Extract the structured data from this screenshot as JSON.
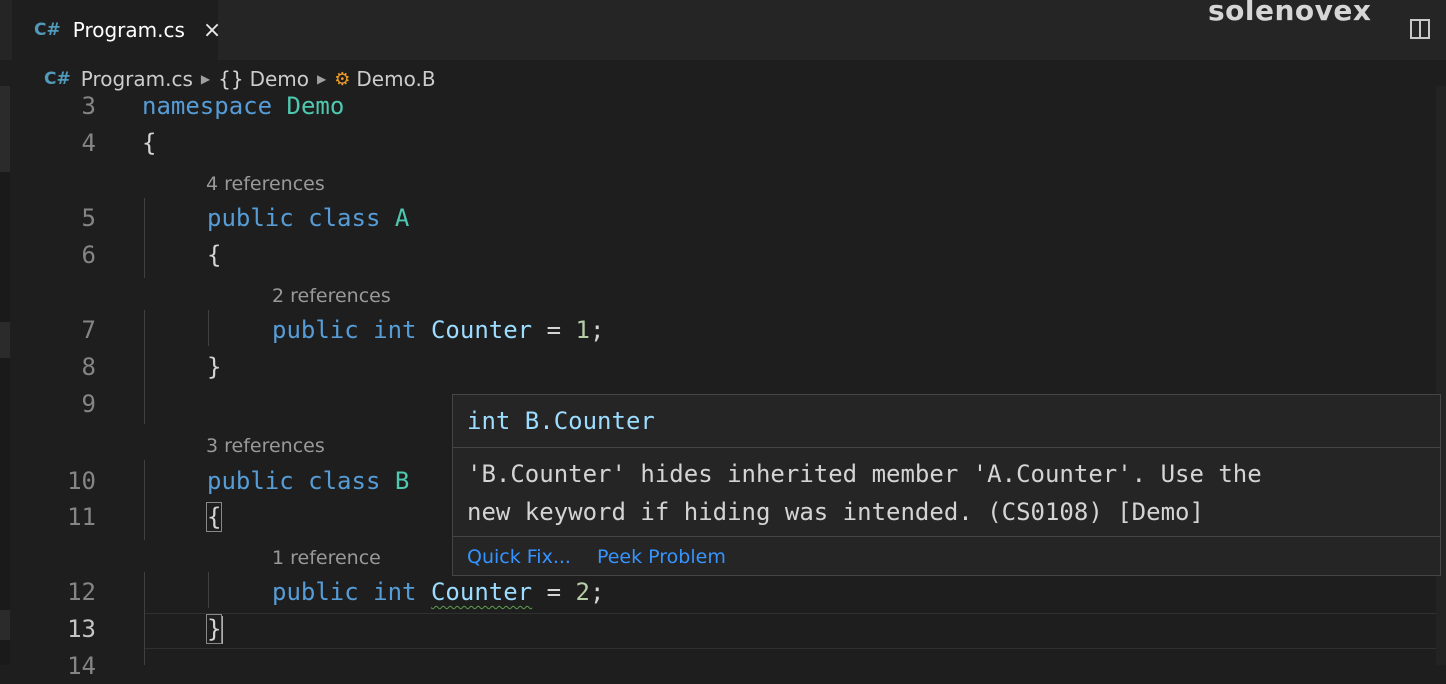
{
  "tab": {
    "label": "Program.cs",
    "icon": "csharp-file-icon",
    "close": "×"
  },
  "watermark": "solenovex",
  "breadcrumb": {
    "file": "Program.cs",
    "namespace_icon": "{}",
    "namespace": "Demo",
    "class": "Demo.B"
  },
  "editor": {
    "line_numbers": [
      "3",
      "4",
      "5",
      "6",
      "7",
      "8",
      "9",
      "10",
      "11",
      "12",
      "13",
      "14"
    ],
    "codelens": [
      "4 references",
      "2 references",
      "3 references",
      "1 reference"
    ],
    "lines": {
      "l3": {
        "kw": "namespace",
        "name": "Demo"
      },
      "l4": "{",
      "l5": {
        "kw1": "public",
        "kw2": "class",
        "name": "A"
      },
      "l6": "{",
      "l7": {
        "kw1": "public",
        "kw2": "int",
        "name": "Counter",
        "op": "=",
        "value": "1",
        "end": ";"
      },
      "l8": "}",
      "l10": {
        "kw1": "public",
        "kw2": "class",
        "name": "B"
      },
      "l11": "{",
      "l12": {
        "kw1": "public",
        "kw2": "int",
        "name": "Counter",
        "op": "=",
        "value": "2",
        "end": ";"
      },
      "l13": "}"
    }
  },
  "hover": {
    "signature": "int B.Counter",
    "message_line1": "'B.Counter' hides inherited member 'A.Counter'. Use the",
    "message_line2": "new keyword if hiding was intended. (CS0108) [Demo]",
    "quick_fix": "Quick Fix...",
    "peek_problem": "Peek Problem"
  },
  "colors": {
    "background": "#1e1e1e",
    "keyword": "#569cd6",
    "type": "#4ec9b0",
    "field": "#9cdcfe",
    "number": "#b5cea8",
    "link": "#3794ff"
  }
}
